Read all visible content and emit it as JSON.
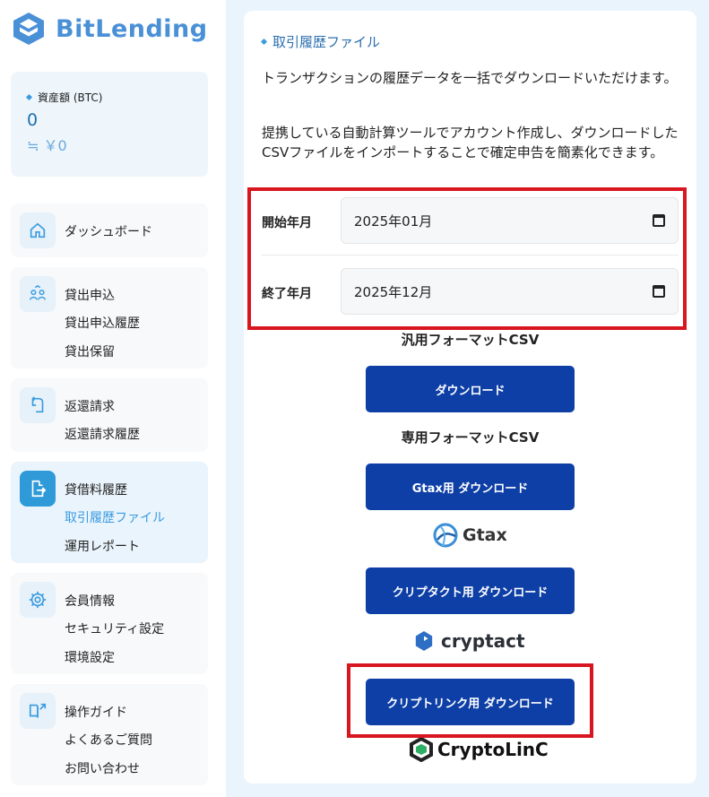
{
  "brand": {
    "logo_text": "BitLending"
  },
  "assets": {
    "label": "資産額 (BTC)",
    "btc_value": "0",
    "jpy_value": "≒ ￥0"
  },
  "nav": {
    "dashboard": "ダッシュボード",
    "lending": {
      "apply": "貸出申込",
      "history": "貸出申込履歴",
      "hold": "貸出保留"
    },
    "return": {
      "request": "返還請求",
      "history": "返還請求履歴"
    },
    "fee": {
      "history": "貸借料履歴",
      "transactions": "取引履歴ファイル",
      "report": "運用レポート"
    },
    "member": {
      "info": "会員情報",
      "security": "セキュリティ設定",
      "env": "環境設定"
    },
    "guide": {
      "guide": "操作ガイド",
      "faq": "よくあるご質問",
      "contact": "お問い合わせ"
    }
  },
  "panel": {
    "title": "取引履歴ファイル",
    "desc1": "トランザクションの履歴データを一括でダウンロードいただけます。",
    "desc2": "提携している自動計算ツールでアカウント作成し、ダウンロードしたCSVファイルをインポートすることで確定申告を簡素化できます。",
    "start_label": "開始年月",
    "start_value": "2025年01月",
    "end_label": "終了年月",
    "end_value": "2025年12月"
  },
  "downloads": {
    "generic_heading": "汎用フォーマットCSV",
    "generic_button": "ダウンロード",
    "dedicated_heading": "専用フォーマットCSV",
    "gtax_button": "Gtax用 ダウンロード",
    "gtax_logo": "Gtax",
    "cryptact_button": "クリプタクト用 ダウンロード",
    "cryptact_logo": "cryptact",
    "cryptolinc_button": "クリプトリンク用 ダウンロード",
    "cryptolinc_logo": "CryptoLinC"
  },
  "colors": {
    "accent": "#3a9be0",
    "button": "#0e3fa6",
    "highlight": "#d8161f"
  }
}
